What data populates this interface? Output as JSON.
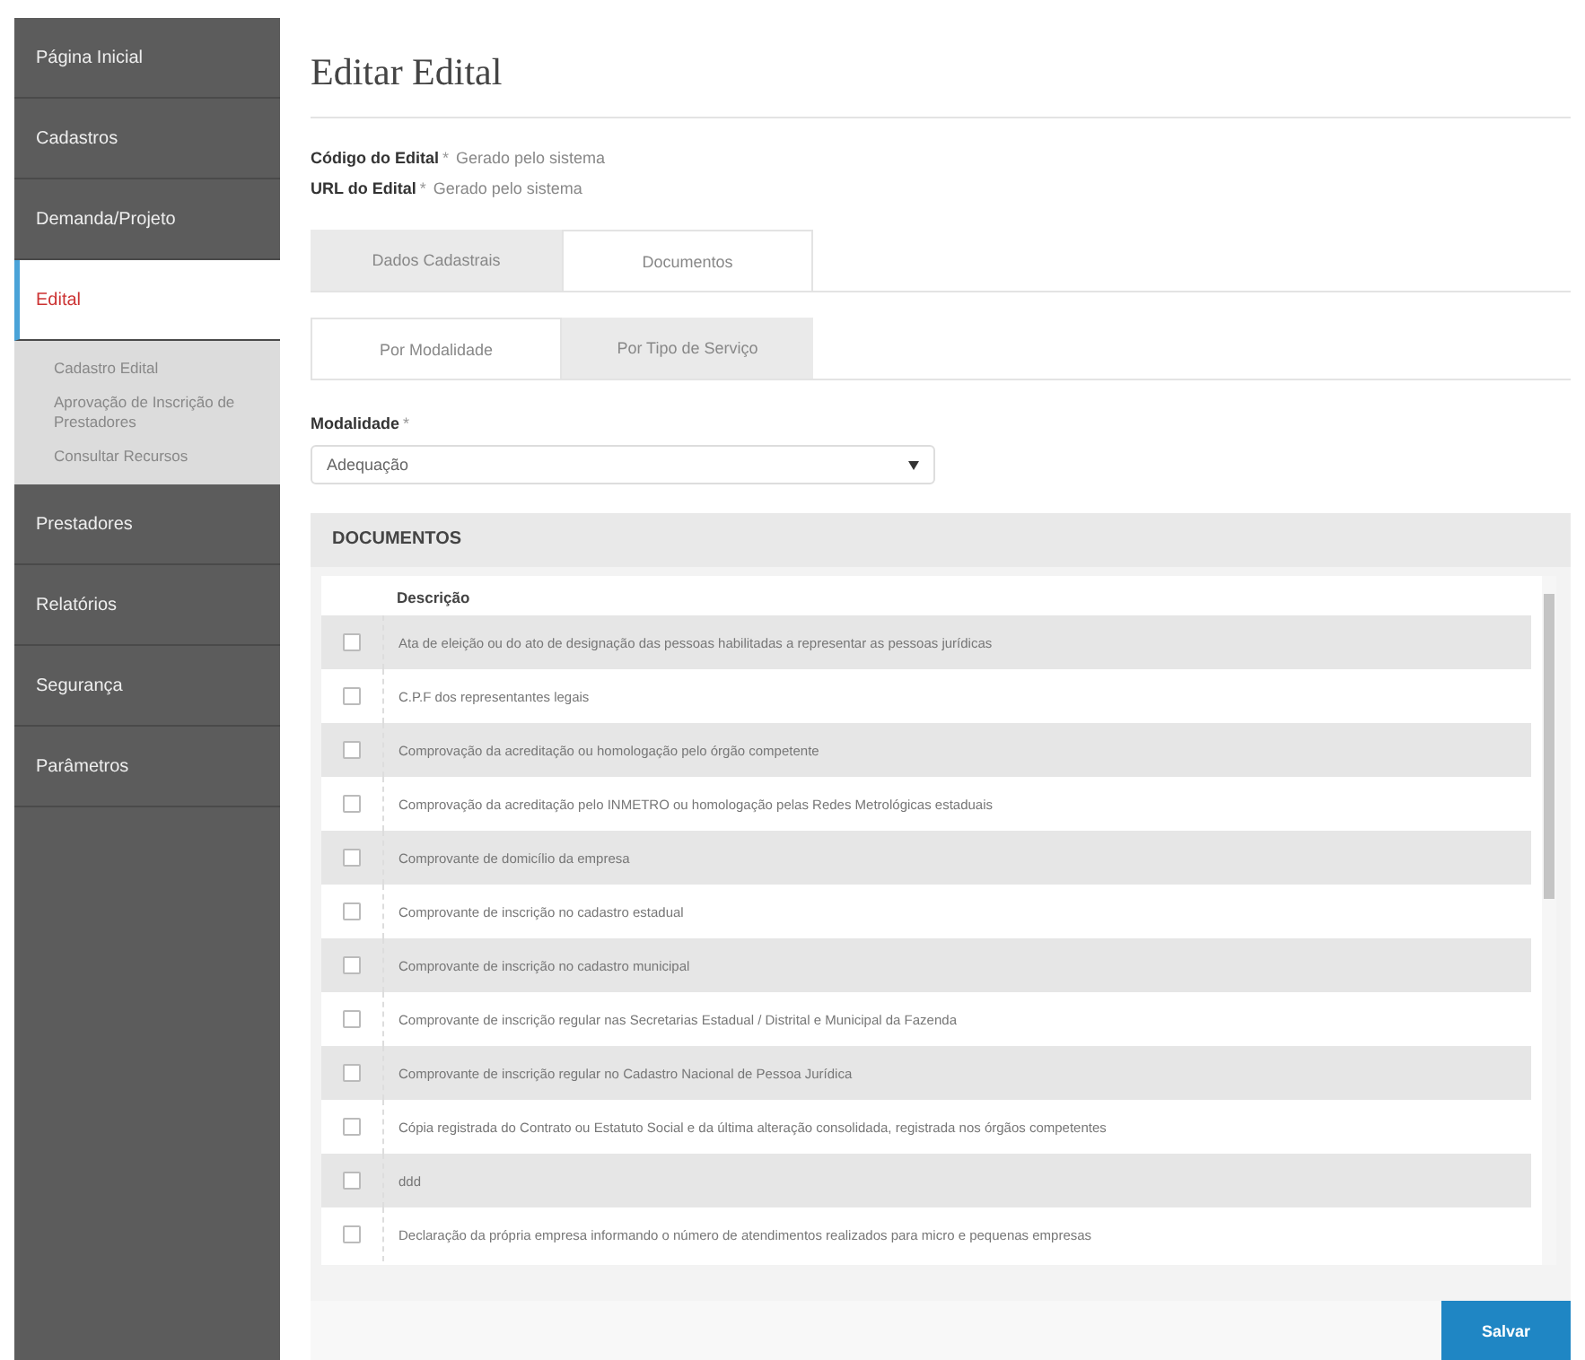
{
  "sidebar": {
    "items": [
      {
        "label": "Página Inicial",
        "selected": false
      },
      {
        "label": "Cadastros",
        "selected": false
      },
      {
        "label": "Demanda/Projeto",
        "selected": false
      },
      {
        "label": "Edital",
        "selected": true,
        "children": [
          {
            "label": "Cadastro Edital"
          },
          {
            "label": "Aprovação de Inscrição de Prestadores"
          },
          {
            "label": "Consultar Recursos"
          }
        ]
      },
      {
        "label": "Prestadores",
        "selected": false
      },
      {
        "label": "Relatórios",
        "selected": false
      },
      {
        "label": "Segurança",
        "selected": false
      },
      {
        "label": "Parâmetros",
        "selected": false
      }
    ]
  },
  "page_title": "Editar Edital",
  "fields": [
    {
      "label": "Código do Edital",
      "required": "*",
      "value": "Gerado pelo sistema"
    },
    {
      "label": "URL do Edital",
      "required": "*",
      "value": "Gerado pelo sistema"
    }
  ],
  "tabs": [
    {
      "label": "Dados Cadastrais",
      "selected": false
    },
    {
      "label": "Documentos",
      "selected": true
    }
  ],
  "subtabs": [
    {
      "label": "Por Modalidade",
      "selected": true
    },
    {
      "label": "Por Tipo de Serviço",
      "selected": false
    }
  ],
  "modalidade": {
    "label": "Modalidade",
    "required": "*",
    "value": "Adequação"
  },
  "documents": {
    "title": "DOCUMENTOS",
    "column": "Descrição",
    "rows": [
      {
        "text": "Ata de eleição ou do ato de designação das pessoas habilitadas a representar as pessoas jurídicas",
        "checked": false
      },
      {
        "text": "C.P.F dos representantes legais",
        "checked": false
      },
      {
        "text": "Comprovação da acreditação ou homologação pelo órgão competente",
        "checked": false
      },
      {
        "text": "Comprovação da acreditação pelo INMETRO ou homologação pelas Redes Metrológicas estaduais",
        "checked": false
      },
      {
        "text": "Comprovante de domicílio da empresa",
        "checked": false
      },
      {
        "text": "Comprovante de inscrição no cadastro estadual",
        "checked": false
      },
      {
        "text": "Comprovante de inscrição no cadastro municipal",
        "checked": false
      },
      {
        "text": "Comprovante de inscrição regular nas Secretarias Estadual / Distrital e Municipal da Fazenda",
        "checked": false
      },
      {
        "text": "Comprovante de inscrição regular no Cadastro Nacional de Pessoa Jurídica",
        "checked": false
      },
      {
        "text": "Cópia registrada do Contrato ou Estatuto Social e da última alteração consolidada, registrada nos órgãos competentes",
        "checked": false
      },
      {
        "text": "ddd",
        "checked": false
      },
      {
        "text": "Declaração da própria empresa informando o número de atendimentos realizados para micro e pequenas empresas",
        "checked": false
      }
    ]
  },
  "save_button": "Salvar"
}
